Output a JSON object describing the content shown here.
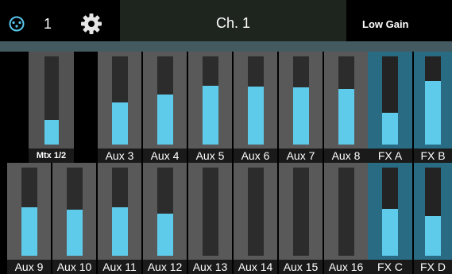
{
  "header": {
    "channel_number": "1",
    "channel_name": "Ch. 1",
    "gain_label": "Low Gain",
    "icons": [
      "network-icon",
      "gear-icon"
    ]
  },
  "colors": {
    "meter_fill": "#5ecbea",
    "fx_cell": "#2a6b84",
    "aux_cell": "#595959",
    "strip": "#435a60"
  },
  "mixes": [
    {
      "label": "Mtx 1/2",
      "level": 0.28
    },
    {
      "label": "Aux 3",
      "level": 0.48
    },
    {
      "label": "Aux 4",
      "level": 0.57
    },
    {
      "label": "Aux 5",
      "level": 0.67
    },
    {
      "label": "Aux 6",
      "level": 0.66
    },
    {
      "label": "Aux 7",
      "level": 0.65
    },
    {
      "label": "Aux 8",
      "level": 0.63
    },
    {
      "label": "FX A",
      "level": 0.36
    },
    {
      "label": "FX B",
      "level": 0.72
    },
    {
      "label": "Aux 9",
      "level": 0.55
    },
    {
      "label": "Aux 10",
      "level": 0.52
    },
    {
      "label": "Aux 11",
      "level": 0.55
    },
    {
      "label": "Aux 12",
      "level": 0.48
    },
    {
      "label": "Aux 13",
      "level": 0.0
    },
    {
      "label": "Aux 14",
      "level": 0.0
    },
    {
      "label": "Aux 15",
      "level": 0.0
    },
    {
      "label": "Aux 16",
      "level": 0.0
    },
    {
      "label": "FX C",
      "level": 0.53
    },
    {
      "label": "FX D",
      "level": 0.45
    }
  ]
}
